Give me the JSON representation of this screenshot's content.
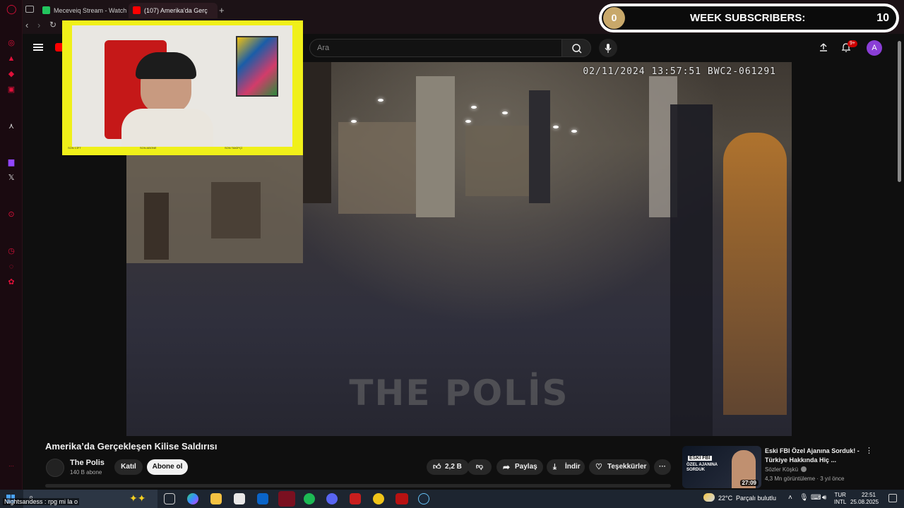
{
  "browser": {
    "tabs": [
      {
        "label": "Meceveiq Stream - Watch"
      },
      {
        "label": "(107) Amerika'da Gerç"
      }
    ]
  },
  "youtube": {
    "search_placeholder": "Ara",
    "notification_badge": "9+",
    "avatar_letter": "A"
  },
  "overlay": {
    "subs_title": "WEEK SUBSCRIBERS:",
    "subs_current": "0",
    "subs_goal": "10",
    "cam_labels": [
      "SON CİFT",
      "SON ABONE",
      "SON TAKİPÇİ"
    ]
  },
  "video": {
    "timestamp": "02/11/2024 13:57:51 BWC2-061291",
    "watermark": "THE POLİS",
    "title": "Amerika’da Gerçekleşen Kilise Saldırısı"
  },
  "channel": {
    "name": "The Polis",
    "subscribers": "140 B abone",
    "join_label": "Katıl",
    "subscribe_label": "Abone ol"
  },
  "actions": {
    "likes": "2,2 B",
    "share": "Paylaş",
    "download": "İndir",
    "thanks": "Teşekkürler",
    "more": "···"
  },
  "recommended": {
    "title": "Eski FBI Özel Ajanına Sorduk! - Türkiye Hakkında Hiç ...",
    "channel": "Sözler Köşkü",
    "meta": "4,3 Mn görüntüleme · 3 yıl önce",
    "duration": "27:09",
    "thumb_text_top": "ESKİ FBI",
    "thumb_text_bottom": "ÖZEL AJANINA SORDUK"
  },
  "taskbar": {
    "chat_ticker": "Nightsandess : rpg mi la o",
    "weather_temp": "22°C",
    "weather_desc": "Parçalı bulutlu",
    "lang_top": "TUR",
    "lang_bottom": "INTL",
    "time": "22:51",
    "date": "25.08.2025"
  },
  "colors": {
    "youtube_red": "#ff0000",
    "opera_red": "#e0103a",
    "overlay_yellow": "#f0f019",
    "overlay_gold": "#c8a86a",
    "avatar_purple": "#8a3ed6"
  }
}
